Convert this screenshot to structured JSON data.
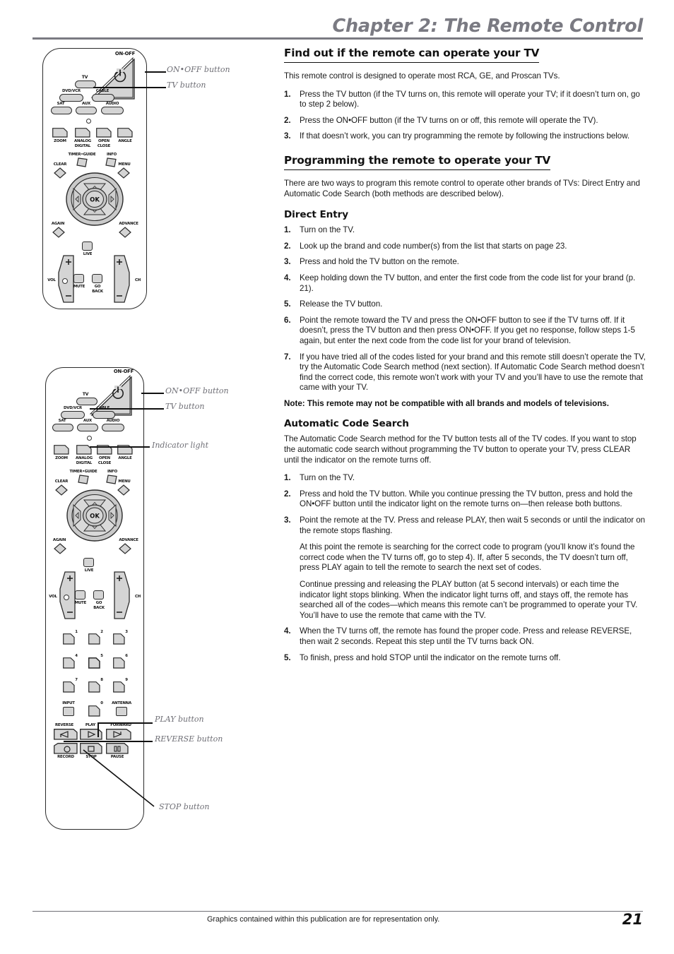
{
  "header": {
    "chapter_title": "Chapter 2: The Remote Control"
  },
  "footer": {
    "note": "Graphics contained within this publication are for representation only.",
    "page_number": "21"
  },
  "content": {
    "section1": {
      "heading": "Find out if the remote can operate your TV",
      "intro": "This remote control is designed to operate most RCA, GE, and Proscan TVs.",
      "steps": [
        {
          "num": "1.",
          "text": "Press the TV button (if the TV turns on, this remote will operate your TV; if it doesn’t turn on, go to step 2 below)."
        },
        {
          "num": "2.",
          "text": "Press the ON•OFF button (if the TV turns on or off, this remote will operate the TV)."
        },
        {
          "num": "3.",
          "text": "If that doesn’t work, you can try programming the remote by following the instructions below."
        }
      ]
    },
    "section2": {
      "heading": "Programming the remote to operate your TV",
      "intro": "There are two ways to program this remote control to operate other brands of TVs: Direct Entry and Automatic Code Search (both methods are described below)."
    },
    "direct_entry": {
      "heading": "Direct Entry",
      "steps": [
        {
          "num": "1.",
          "text": "Turn on the TV."
        },
        {
          "num": "2.",
          "text": "Look up the brand and code number(s) from the list that starts on page 23."
        },
        {
          "num": "3.",
          "text": "Press and hold the TV button on the remote."
        },
        {
          "num": "4.",
          "text": "Keep holding down the TV button, and enter the first code from the code list for your brand (p. 21)."
        },
        {
          "num": "5.",
          "text": "Release the TV button."
        },
        {
          "num": "6.",
          "text": "Point the remote toward the TV and press the ON•OFF button to see if the TV turns off. If it doesn’t, press the TV button and then press ON•OFF. If you get no response, follow steps 1-5 again, but enter the next code from the code list for your brand of television."
        },
        {
          "num": "7.",
          "text": "If you have tried all of the codes listed for your brand and this remote still doesn’t operate the TV, try the Automatic Code Search method (next section). If Automatic Code Search method doesn’t find the correct code, this remote won’t work with your TV and you’ll have to use the remote that came with your TV."
        }
      ],
      "note": "Note: This remote may not be compatible with all brands and models of televisions."
    },
    "auto_code_search": {
      "heading": "Automatic Code Search",
      "intro": "The Automatic Code Search method for the TV button tests all of the TV codes. If you want to stop the automatic code search without programming the TV button to operate your TV, press CLEAR until the indicator on the remote turns off.",
      "steps": [
        {
          "num": "1.",
          "text": "Turn on the TV."
        },
        {
          "num": "2.",
          "text": "Press and hold the TV button. While you continue pressing the TV button, press and hold the ON•OFF button until the indicator light on the remote turns on—then release both buttons."
        },
        {
          "num": "3.",
          "text": "Point the remote at the TV. Press and release PLAY, then wait 5 seconds or until the indicator on the remote stops flashing.",
          "cont1": "At this point the remote is searching for the correct code to program (you’ll know it’s found the correct code when the TV turns off, go to step 4). If, after 5 seconds, the TV doesn’t turn off, press PLAY again to tell the remote to search the next set of codes.",
          "cont2": "Continue pressing and releasing the PLAY button (at 5 second intervals) or each time the indicator light stops blinking. When the indicator light turns off, and stays off, the remote has searched all of the codes—which means this remote can’t be programmed to operate your TV. You’ll have to use the remote that came with the TV."
        },
        {
          "num": "4.",
          "text": "When the TV turns off, the remote has found the proper code. Press and release REVERSE, then wait 2 seconds. Repeat this step until the TV turns back ON."
        },
        {
          "num": "5.",
          "text": "To finish, press and hold STOP until the indicator on the remote turns off."
        }
      ]
    }
  },
  "figures": {
    "remote_top": {
      "callouts": [
        {
          "id": "onoff",
          "text": "ON•OFF button"
        },
        {
          "id": "tv",
          "text": "TV button"
        }
      ],
      "buttons": {
        "onoff": "ON-OFF",
        "tv": "TV",
        "dvdvcr": "DVD/VCR",
        "cable": "CABLE",
        "sat": "SAT",
        "aux": "AUX",
        "audio": "AUDIO",
        "zoom": "ZOOM",
        "analog": "ANALOG",
        "digital": "DIGITAL",
        "open": "OPEN",
        "close": "CLOSE",
        "angle": "ANGLE",
        "timer_guide": "TIMER•GUIDE",
        "info": "INFO",
        "clear": "CLEAR",
        "menu": "MENU",
        "ok": "OK",
        "again": "AGAIN",
        "advance": "ADVANCE",
        "live": "LIVE",
        "vol": "VOL",
        "ch": "CH",
        "mute": "MUTE",
        "go": "GO",
        "back": "BACK",
        "plus": "+",
        "minus": "–"
      }
    },
    "remote_bottom": {
      "callouts": [
        {
          "id": "onoff",
          "text": "ON•OFF button"
        },
        {
          "id": "tv",
          "text": "TV button"
        },
        {
          "id": "indicator",
          "text": "Indicator light"
        },
        {
          "id": "play",
          "text": "PLAY button"
        },
        {
          "id": "reverse",
          "text": "REVERSE button"
        },
        {
          "id": "stop",
          "text": "STOP button"
        }
      ],
      "buttons": {
        "onoff": "ON-OFF",
        "tv": "TV",
        "dvdvcr": "DVD/VCR",
        "cable": "CABLE",
        "sat": "SAT",
        "aux": "AUX",
        "audio": "AUDIO",
        "zoom": "ZOOM",
        "analog": "ANALOG",
        "digital": "DIGITAL",
        "open": "OPEN",
        "close": "CLOSE",
        "angle": "ANGLE",
        "timer_guide": "TIMER•GUIDE",
        "info": "INFO",
        "clear": "CLEAR",
        "menu": "MENU",
        "ok": "OK",
        "again": "AGAIN",
        "advance": "ADVANCE",
        "live": "LIVE",
        "vol": "VOL",
        "ch": "CH",
        "mute": "MUTE",
        "go": "GO",
        "back": "BACK",
        "plus": "+",
        "minus": "–",
        "n1": "1",
        "n2": "2",
        "n3": "3",
        "n4": "4",
        "n5": "5",
        "n6": "6",
        "n7": "7",
        "n8": "8",
        "n9": "9",
        "n0": "0",
        "input": "INPUT",
        "antenna": "ANTENNA",
        "reverse": "REVERSE",
        "play": "PLAY",
        "forward": "FORWARD",
        "record": "RECORD",
        "stop": "STOP",
        "pause": "PAUSE"
      }
    }
  },
  "colors": {
    "header_gray": "#7a7a82",
    "button_fill": "#d4d4d4",
    "outline": "#2b2b2b",
    "callout_gray": "#6f6f76"
  }
}
